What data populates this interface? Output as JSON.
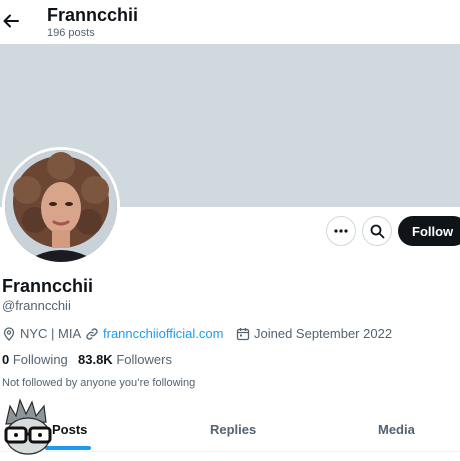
{
  "header": {
    "display_name": "Franncchii",
    "posts_count": "196 posts"
  },
  "profile": {
    "display_name": "Franncchii",
    "handle": "@franncchii",
    "location": "NYC | MIA",
    "website": "franncchiiofficial.com",
    "joined": "Joined September 2022",
    "following_count": "0",
    "following_label": "Following",
    "followers_count": "83.8K",
    "followers_label": "Followers",
    "not_followed": "Not followed by anyone you’re following"
  },
  "actions": {
    "follow_label": "Follow"
  },
  "tabs": [
    {
      "label": "Posts",
      "active": true
    },
    {
      "label": "Replies",
      "active": false
    },
    {
      "label": "Media",
      "active": false
    }
  ],
  "colors": {
    "accent": "#1d9bf0",
    "banner": "#cfd9de",
    "text": "#0f1419",
    "muted": "#536471"
  }
}
